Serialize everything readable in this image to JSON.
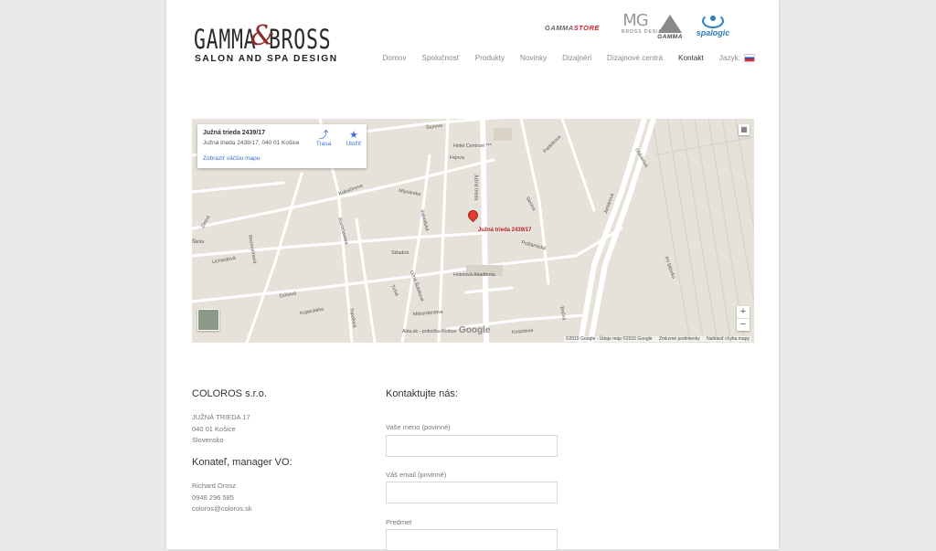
{
  "header": {
    "logo": {
      "word": "GAMMA BROSS",
      "amp": "&",
      "subtitle": "SALON AND SPA DESIGN"
    },
    "brands": {
      "gammastore_a": "GAMMA",
      "gammastore_b": "STORE",
      "mg_big": "MG",
      "mg_small": "BROSS DESIGN",
      "gamma": "GAMMA",
      "spalogic": "spalogic"
    },
    "nav": [
      {
        "label": "Domov"
      },
      {
        "label": "Spoločnosť"
      },
      {
        "label": "Produkty"
      },
      {
        "label": "Novinky"
      },
      {
        "label": "Dizajnéri"
      },
      {
        "label": "Dizajnové centrá"
      },
      {
        "label": "Kontakt"
      },
      {
        "label": "Jazyk:"
      }
    ]
  },
  "map": {
    "infobox": {
      "title": "Južná trieda 2439/17",
      "address": "Južná trieda 2439/17, 040 01 Košice",
      "link": "Zobraziť väčšiu mapu",
      "route": "Trasa",
      "save": "Uložiť"
    },
    "marker_label": "Južná trieda 2439/17",
    "streets": [
      "Šturova",
      "Hotel Centrum ***",
      "Fejova",
      "Kukučínova",
      "Mlynárska",
      "Južná trieda",
      "Palárikova",
      "Sienna",
      "Jantárová",
      "Rastislavova",
      "Rozmarínová",
      "Lichardová",
      "Skladná",
      "Dúhová",
      "Požiarnická",
      "Hotelová Akadémia",
      "Užná Šulekova",
      "Milosrdenstva",
      "Alza.sk - pobočka Košice",
      "Kostolová",
      "Pri bitúnku",
      "Bočná",
      "Tichá",
      "Topoľová",
      "Kupeckého",
      "Vojvodská",
      "Škola",
      "Zimná",
      "Uhlisková"
    ],
    "google": "Google",
    "attribution": [
      "©2015 Google - Údaje máp ©2015 Google",
      "Zmluvné podmienky",
      "Nahlásiť chybu mapy"
    ],
    "zoom_in": "+",
    "zoom_out": "−"
  },
  "company": {
    "name": "COLOROS s.r.o.",
    "address_lines": [
      "JUŽNÁ TRIEDA 17",
      "040 01 Košice",
      "Slovensko"
    ],
    "manager_title": "Konateľ, manager VO:",
    "manager_lines": [
      "Richard Orosz",
      "0948 296 585",
      "coloros@coloros.sk"
    ]
  },
  "form": {
    "title": "Kontaktujte nás:",
    "fields": [
      {
        "label": "Vaše meno (povinné)",
        "value": ""
      },
      {
        "label": "Váš email (povinné)",
        "value": ""
      },
      {
        "label": "Predmet",
        "value": ""
      }
    ]
  }
}
